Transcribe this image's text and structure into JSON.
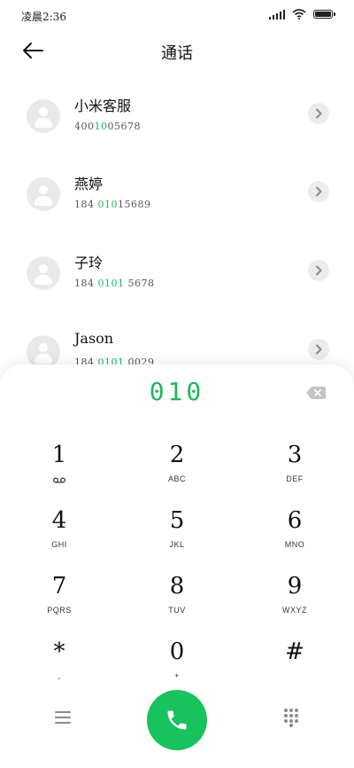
{
  "status_bar": {
    "time": "凌晨2:36"
  },
  "header": {
    "title": "通话",
    "back_icon": "arrow-left-icon"
  },
  "contacts": [
    {
      "name": "小米客服",
      "number_prefix": "400",
      "number_match": "10",
      "number_suffix": "05678"
    },
    {
      "name": "燕婷",
      "number_prefix": "184 ",
      "number_match": "010",
      "number_suffix": "15689"
    },
    {
      "name": "子玲",
      "number_prefix": "184 ",
      "number_match": "0101",
      "number_suffix": " 5678"
    },
    {
      "name": "Jason",
      "number_prefix": "184 ",
      "number_match": "0101",
      "number_suffix": " 0029"
    }
  ],
  "dialer": {
    "input_value": "010",
    "keys": [
      {
        "digit": "1",
        "letters": ""
      },
      {
        "digit": "2",
        "letters": "ABC"
      },
      {
        "digit": "3",
        "letters": "DEF"
      },
      {
        "digit": "4",
        "letters": "GHI"
      },
      {
        "digit": "5",
        "letters": "JKL"
      },
      {
        "digit": "6",
        "letters": "MNO"
      },
      {
        "digit": "7",
        "letters": "PQRS"
      },
      {
        "digit": "8",
        "letters": "TUV"
      },
      {
        "digit": "9",
        "letters": "WXYZ"
      },
      {
        "digit": "*",
        "letters": ","
      },
      {
        "digit": "0",
        "letters": "+"
      },
      {
        "digit": "#",
        "letters": ""
      }
    ]
  },
  "colors": {
    "accent": "#1fb75a",
    "call_button": "#18c25c"
  }
}
